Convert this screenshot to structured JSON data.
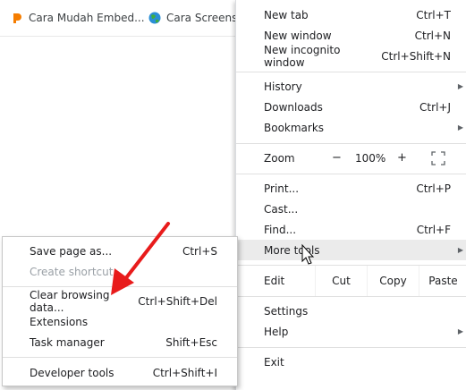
{
  "bookmarks": [
    {
      "label": "Cara Mudah Embed...",
      "icon": "blogger-icon"
    },
    {
      "label": "Cara Screensh",
      "icon": "globe-icon"
    }
  ],
  "menu": {
    "new_tab": {
      "label": "New tab",
      "shortcut": "Ctrl+T"
    },
    "new_window": {
      "label": "New window",
      "shortcut": "Ctrl+N"
    },
    "new_incognito": {
      "label": "New incognito window",
      "shortcut": "Ctrl+Shift+N"
    },
    "history": {
      "label": "History"
    },
    "downloads": {
      "label": "Downloads",
      "shortcut": "Ctrl+J"
    },
    "bookmarks": {
      "label": "Bookmarks"
    },
    "zoom": {
      "label": "Zoom",
      "minus": "−",
      "value": "100%",
      "plus": "+"
    },
    "print": {
      "label": "Print...",
      "shortcut": "Ctrl+P"
    },
    "cast": {
      "label": "Cast..."
    },
    "find": {
      "label": "Find...",
      "shortcut": "Ctrl+F"
    },
    "more_tools": {
      "label": "More tools"
    },
    "edit": {
      "label": "Edit",
      "cut": "Cut",
      "copy": "Copy",
      "paste": "Paste"
    },
    "settings": {
      "label": "Settings"
    },
    "help": {
      "label": "Help"
    },
    "exit": {
      "label": "Exit"
    }
  },
  "submenu": {
    "save_page": {
      "label": "Save page as...",
      "shortcut": "Ctrl+S"
    },
    "create_shortcut": {
      "label": "Create shortcut..."
    },
    "clear_browsing": {
      "label": "Clear browsing data...",
      "shortcut": "Ctrl+Shift+Del"
    },
    "extensions": {
      "label": "Extensions"
    },
    "task_manager": {
      "label": "Task manager",
      "shortcut": "Shift+Esc"
    },
    "developer_tools": {
      "label": "Developer tools",
      "shortcut": "Ctrl+Shift+I"
    }
  },
  "colors": {
    "accent_arrow": "#e81b1b",
    "hover_bg": "#ebebeb"
  }
}
